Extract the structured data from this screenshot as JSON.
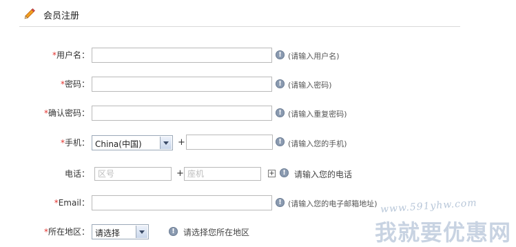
{
  "header": {
    "title": "会员注册"
  },
  "form": {
    "username": {
      "required": "*",
      "label": "用户名：",
      "value": "",
      "hint": "(请输入用户名)"
    },
    "password": {
      "required": "*",
      "label": "密码：",
      "value": "",
      "hint": "(请输入密码)"
    },
    "confirm": {
      "required": "*",
      "label": "确认密码：",
      "value": "",
      "hint": "(请输入重复密码)"
    },
    "mobile": {
      "required": "*",
      "label": "手机：",
      "country": "China(中国)",
      "plus": "+",
      "value": "",
      "hint": "(请输入您的手机)"
    },
    "phone": {
      "label": "电话：",
      "area_placeholder": "区号",
      "plus": "+",
      "number_placeholder": "座机",
      "add": "+",
      "hint": "请输入您的电话"
    },
    "email": {
      "required": "*",
      "label": "Email：",
      "value": "",
      "hint": "(请输入您的电子邮箱地址)"
    },
    "region": {
      "required": "*",
      "label": "所在地区：",
      "selected": "请选择",
      "hint": "请选择您所在地区"
    }
  },
  "watermark": {
    "url": "www.591yhw.com",
    "brand": "我就要优惠网"
  },
  "icons": {
    "pencil": "pencil-icon",
    "info": "info-icon",
    "dropdown": "chevron-down-icon"
  }
}
